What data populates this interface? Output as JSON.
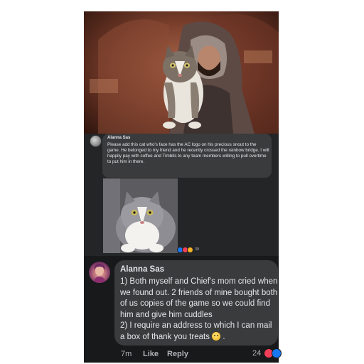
{
  "first_comment": {
    "author": "Alanna Sas",
    "text": "Please add this cat who's face has the AC logo on his precious snout to the game. He belonged to my friend and he recently crossed the rainbow bridge. I will happily pay with coffee and Timbits to any team members willing to pull overtime to put him in there.",
    "reaction_count": "39",
    "reaction_icons": [
      "like-icon",
      "love-icon",
      "haha-icon"
    ]
  },
  "second_comment": {
    "author": "Alanna Sas",
    "text_line1": "1) Both myself and Chief's mom cried when we found out.  2 friends of mine bought both of us copies of the game so we could find him and give him cuddles",
    "text_line2": "2) I require an address to which I can mail a box of thank you treats ",
    "emoji": "smile-emoji",
    "time": "7m",
    "like_label": "Like",
    "reply_label": "Reply",
    "reaction_count": "24",
    "reaction_icons": [
      "love-icon",
      "like-icon"
    ]
  },
  "colors": {
    "dark_background": "#18191a",
    "bubble": "#3a3b3c",
    "text": "#e4e6eb",
    "secondary_text": "#b0b3b8",
    "like_blue": "#1877f2",
    "love_red": "#f33e58"
  }
}
